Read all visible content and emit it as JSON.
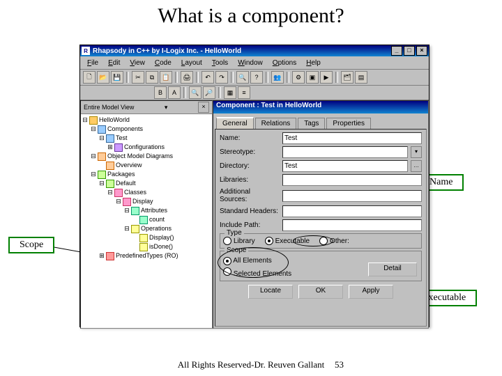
{
  "slide": {
    "title": "What is a component?",
    "footer": "All Rights Reserved-Dr. Reuven Gallant",
    "page_number": "53"
  },
  "callouts": {
    "name": "Name",
    "scope": "Scope",
    "executable": "Executable"
  },
  "window": {
    "title": "Rhapsody in C++ by I-Logix Inc. - HelloWorld"
  },
  "menu": [
    "File",
    "Edit",
    "View",
    "Code",
    "Layout",
    "Tools",
    "Window",
    "Options",
    "Help"
  ],
  "browser": {
    "view_label": "Entire Model View",
    "root": "HelloWorld",
    "components": {
      "label": "Components",
      "item": "Test",
      "configs": "Configurations"
    },
    "omd": {
      "label": "Object Model Diagrams",
      "item": "Overview"
    },
    "packages": {
      "label": "Packages",
      "default": "Default",
      "classes": {
        "label": "Classes",
        "display": "Display",
        "attributes": {
          "label": "Attributes",
          "item": "count"
        },
        "operations": {
          "label": "Operations",
          "op1": "Display()",
          "op2": "isDone()"
        }
      }
    },
    "predef": "PredefinedTypes (RO)"
  },
  "panel": {
    "title": "Component : Test in HelloWorld",
    "tabs": [
      "General",
      "Relations",
      "Tags",
      "Properties"
    ],
    "fields": {
      "name_label": "Name:",
      "name_value": "Test",
      "stereotype_label": "Stereotype:",
      "stereotype_value": "",
      "directory_label": "Directory:",
      "directory_value": "Test",
      "libraries_label": "Libraries:",
      "libraries_value": "",
      "addsrc_label": "Additional Sources:",
      "addsrc_value": "",
      "stdhdr_label": "Standard Headers:",
      "stdhdr_value": "",
      "incpath_label": "Include Path:",
      "incpath_value": ""
    },
    "type": {
      "legend": "Type",
      "library": "Library",
      "executable": "Executable",
      "other": "Other:"
    },
    "scope": {
      "legend": "Scope",
      "all": "All Elements",
      "selected": "Selected Elements"
    },
    "detail_btn": "Detail",
    "buttons": {
      "locate": "Locate",
      "ok": "OK",
      "apply": "Apply"
    }
  }
}
